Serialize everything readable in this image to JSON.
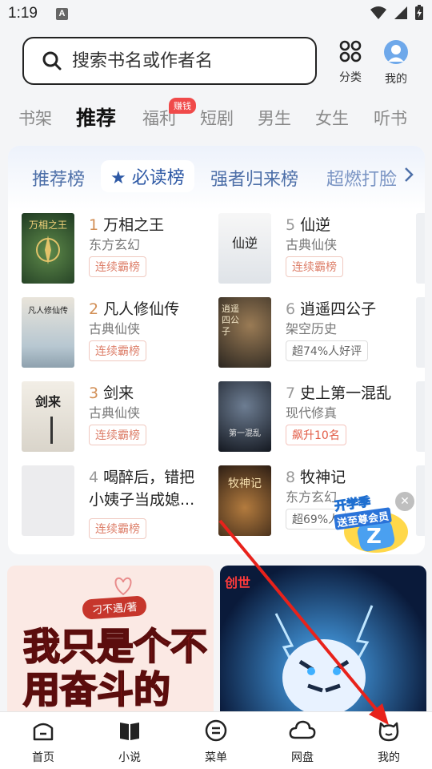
{
  "status": {
    "time": "1:19",
    "notif_letter": "A"
  },
  "search": {
    "placeholder": "搜索书名或作者名"
  },
  "top_buttons": {
    "category": "分类",
    "mine": "我的"
  },
  "category_tabs": [
    {
      "label": "书架"
    },
    {
      "label": "推荐",
      "active": true
    },
    {
      "label": "福利",
      "badge": "赚钱"
    },
    {
      "label": "短剧"
    },
    {
      "label": "男生"
    },
    {
      "label": "女生"
    },
    {
      "label": "听书"
    }
  ],
  "rank_tabs": [
    {
      "label": "推荐榜"
    },
    {
      "label": "★ 必读榜",
      "active": true
    },
    {
      "label": "强者归来榜"
    },
    {
      "label": "超燃打脸"
    }
  ],
  "books": [
    {
      "rank": "1",
      "title": "万相之王",
      "genre": "东方玄幻",
      "tag": "连续霸榜",
      "cover_text": "万相之王"
    },
    {
      "rank": "2",
      "title": "凡人修仙传",
      "genre": "古典仙侠",
      "tag": "连续霸榜",
      "cover_text": "凡人修仙传"
    },
    {
      "rank": "3",
      "title": "剑来",
      "genre": "古典仙侠",
      "tag": "连续霸榜",
      "cover_text": "剑来"
    },
    {
      "rank": "4",
      "title_line1": "喝醉后，错把",
      "title_line2": "小姨子当成媳...",
      "tag": "连续霸榜"
    },
    {
      "rank": "5",
      "title": "仙逆",
      "genre": "古典仙侠",
      "tag": "连续霸榜",
      "cover_text": "仙逆"
    },
    {
      "rank": "6",
      "title": "逍遥四公子",
      "genre": "架空历史",
      "tag": "超74%人好评",
      "cover_text": "逍遥四公子"
    },
    {
      "rank": "7",
      "title": "史上第一混乱",
      "genre": "现代修真",
      "tag": "飙升10名",
      "cover_text": "第一混乱"
    },
    {
      "rank": "8",
      "title": "牧神记",
      "genre": "东方玄幻",
      "tag": "超69%人",
      "cover_text": "牧神记"
    }
  ],
  "promo": {
    "line1": "开学季",
    "line2": "送至尊会员"
  },
  "feed": [
    {
      "author": "刁不遇/著",
      "title": "我只是个不用奋斗的"
    },
    {
      "brand": "创世"
    }
  ],
  "bottom_nav": [
    {
      "label": "首页"
    },
    {
      "label": "小说"
    },
    {
      "label": "菜单"
    },
    {
      "label": "网盘"
    },
    {
      "label": "我的"
    }
  ],
  "colors": {
    "accent_blue": "#2e59a5",
    "rank_orange": "#d28f56",
    "annotation_red": "#e8221b"
  }
}
